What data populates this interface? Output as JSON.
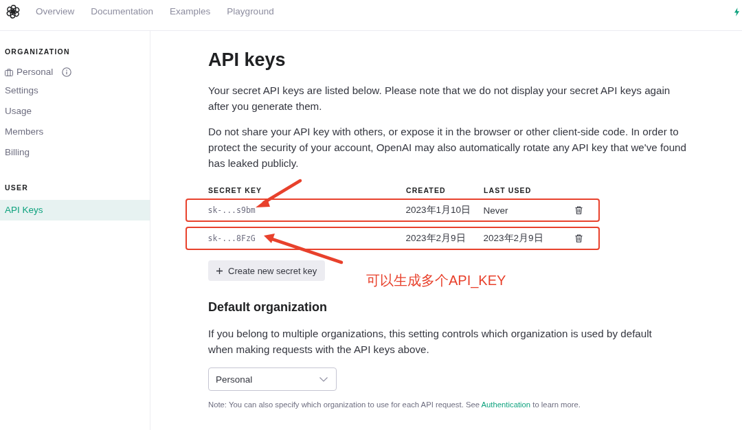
{
  "nav": {
    "links": [
      {
        "label": "Overview"
      },
      {
        "label": "Documentation"
      },
      {
        "label": "Examples"
      },
      {
        "label": "Playground"
      }
    ]
  },
  "sidebar": {
    "sections": [
      {
        "heading": "ORGANIZATION",
        "items": [
          {
            "label": "Personal",
            "kind": "organization",
            "selected": false
          },
          {
            "label": "Settings",
            "kind": "link",
            "selected": false
          },
          {
            "label": "Usage",
            "kind": "link",
            "selected": false
          },
          {
            "label": "Members",
            "kind": "link",
            "selected": false
          },
          {
            "label": "Billing",
            "kind": "link",
            "selected": false
          }
        ]
      },
      {
        "heading": "USER",
        "items": [
          {
            "label": "API Keys",
            "kind": "link",
            "selected": true
          }
        ]
      }
    ]
  },
  "page": {
    "title": "API keys",
    "paragraphs": [
      "Your secret API keys are listed below. Please note that we do not display your secret API keys again after you generate them.",
      "Do not share your API key with others, or expose it in the browser or other client-side code. In order to protect the security of your account, OpenAI may also automatically rotate any API key that we've found has leaked publicly."
    ]
  },
  "keys_table": {
    "columns": [
      "SECRET KEY",
      "CREATED",
      "LAST USED"
    ],
    "rows": [
      {
        "secret_key": "sk-...s9bm",
        "created": "2023年1月10日",
        "last_used": "Never",
        "highlighted": true
      },
      {
        "secret_key": "sk-...8FzG",
        "created": "2023年2月9日",
        "last_used": "2023年2月9日",
        "highlighted": true
      }
    ]
  },
  "create_button": {
    "label": "Create new secret key"
  },
  "annotation": {
    "text": "可以生成多个API_KEY"
  },
  "default_organization": {
    "title": "Default organization",
    "description": "If you belong to multiple organizations, this setting controls which organization is used by default when making requests with the API keys above.",
    "select": {
      "value": "Personal"
    },
    "note": {
      "before": "Note: You can also specify which organization to use for each API request. See ",
      "link": "Authentication",
      "after": " to learn more."
    }
  }
}
